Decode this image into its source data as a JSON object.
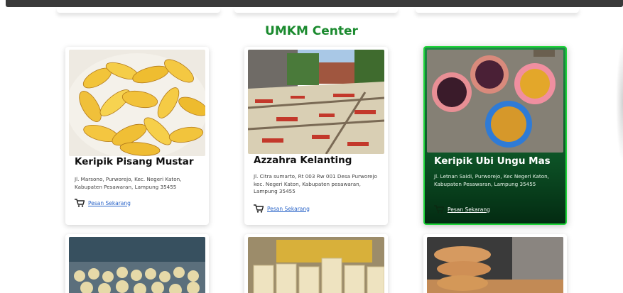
{
  "section": {
    "title": "UMKM Center"
  },
  "cards": [
    {
      "name": "Keripik Pisang Mustar",
      "address": "Jl. Marsono, Purworejo, Kec. Negeri Katon, Kabupaten Pesawaran, Lampung 35455",
      "order_label": "Pesan Sekarang"
    },
    {
      "name": "Azzahra Kelanting",
      "address": "Jl. Citra sumarto, Rt 003 Rw 001 Desa Purworejo kec. Negeri Katon, Kabupaten pesawaran, Lampung 35455",
      "order_label": "Pesan Sekarang"
    },
    {
      "name": "Keripik Ubi Ungu Mas",
      "address": "Jl. Letnan Saidi, Purworejo, Kec Negeri Katon, Kabupaten Pesawaran, Lampung 35455",
      "order_label": "Pesan Sekarang"
    }
  ],
  "colors": {
    "title_green": "#1a8a2e",
    "active_border": "#1fd43a",
    "link_blue": "#2a64c8"
  },
  "icons": {
    "order": "shopping-cart-icon"
  }
}
